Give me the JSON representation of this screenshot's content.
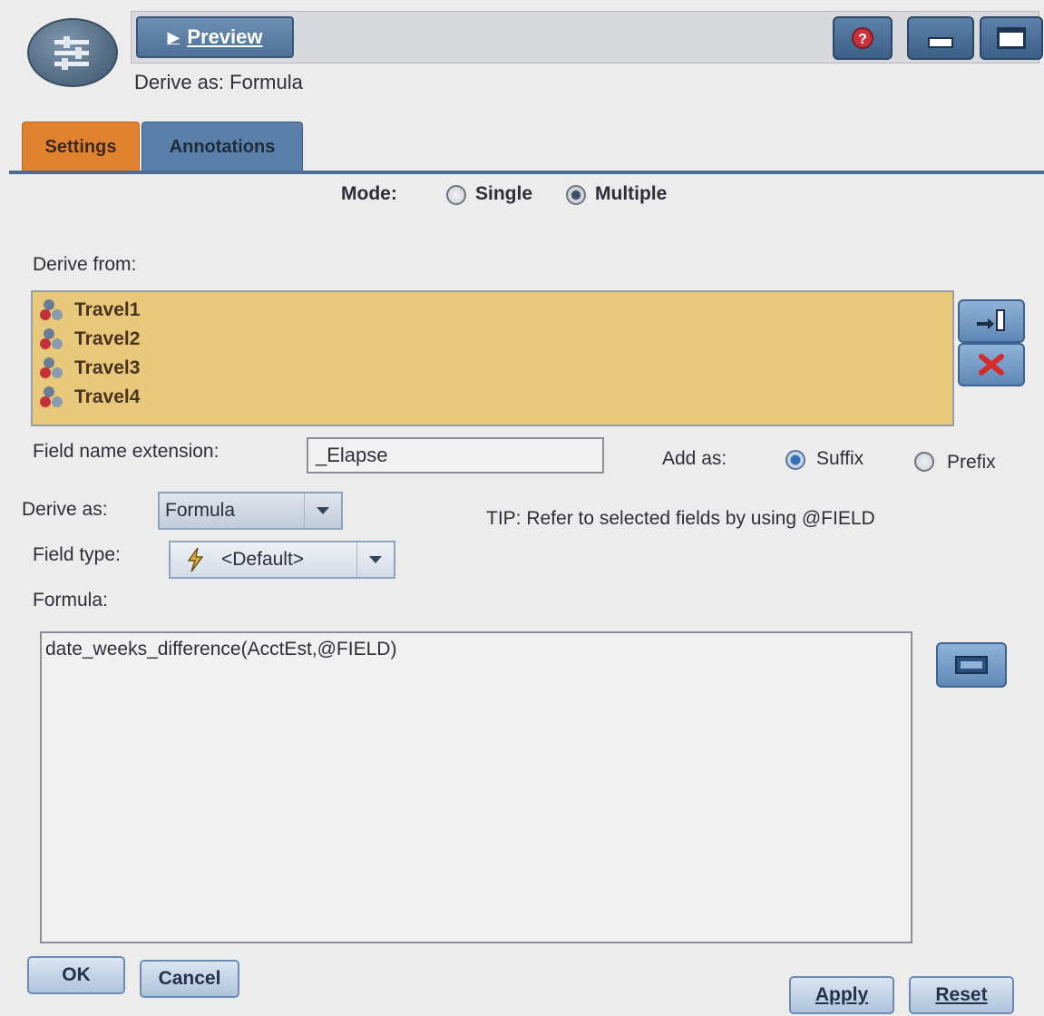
{
  "header": {
    "preview_label": "Preview",
    "subtitle": "Derive as: Formula"
  },
  "tabs": [
    {
      "label": "Settings",
      "active": true
    },
    {
      "label": "Annotations",
      "active": false
    }
  ],
  "mode": {
    "label": "Mode:",
    "options": [
      {
        "label": "Single",
        "selected": false
      },
      {
        "label": "Multiple",
        "selected": true
      }
    ]
  },
  "derive_from": {
    "label": "Derive from:",
    "fields": [
      "Travel1",
      "Travel2",
      "Travel3",
      "Travel4"
    ]
  },
  "field_name_extension": {
    "label": "Field name extension:",
    "value": "_Elapse"
  },
  "add_as": {
    "label": "Add as:",
    "options": [
      {
        "label": "Suffix",
        "selected": true
      },
      {
        "label": "Prefix",
        "selected": false
      }
    ]
  },
  "derive_as": {
    "label": "Derive as:",
    "value": "Formula"
  },
  "tip": "TIP: Refer to selected fields by using @FIELD",
  "field_type": {
    "label": "Field type:",
    "value": "<Default>"
  },
  "formula": {
    "label": "Formula:",
    "value": "date_weeks_difference(AcctEst,@FIELD)"
  },
  "buttons": {
    "ok": "OK",
    "cancel": "Cancel",
    "apply": "Apply",
    "reset": "Reset"
  },
  "colors": {
    "settings_tab": "#e0822f",
    "annotations_tab": "#5a7fa8",
    "field_list_bg": "#e8c87a",
    "accent_blue": "#4d6b8f"
  }
}
